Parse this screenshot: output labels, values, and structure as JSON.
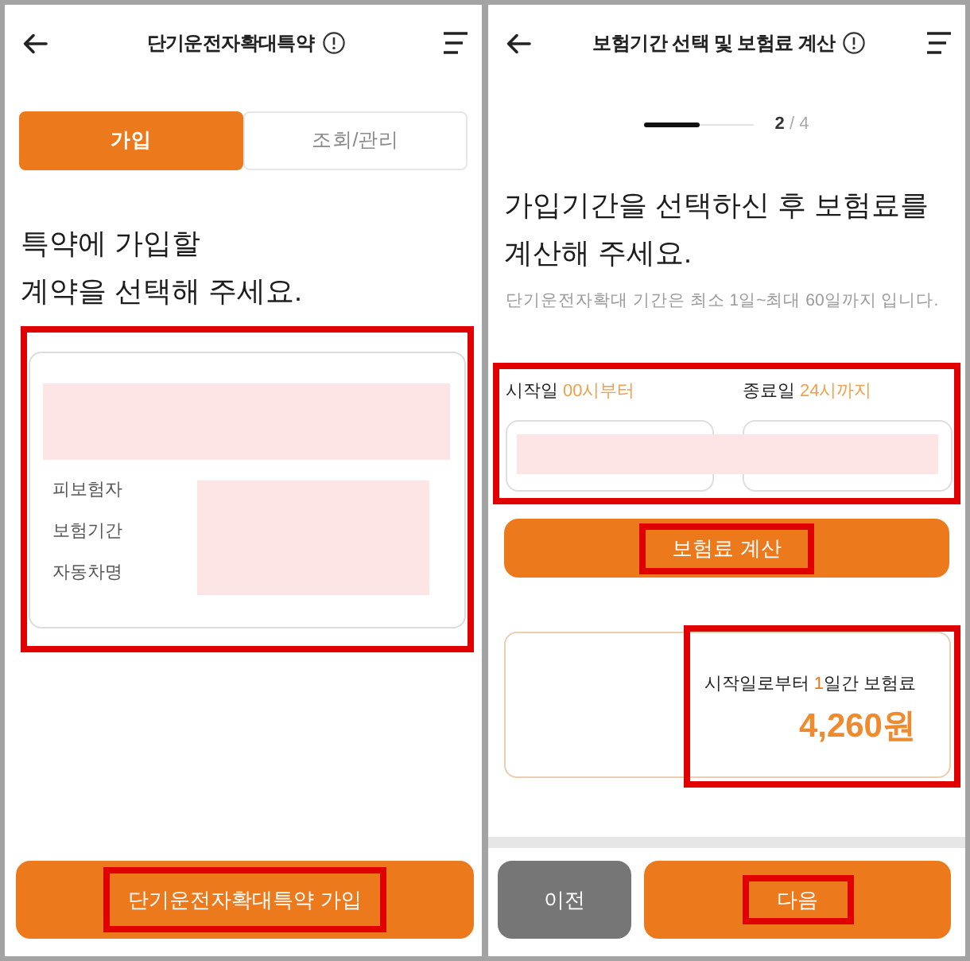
{
  "screens": [
    {
      "kind": "join",
      "header": {
        "title": "단기운전자확대특약"
      },
      "tabs": [
        {
          "label": "가입",
          "selected": true
        },
        {
          "label": "조회/관리",
          "selected": false
        }
      ],
      "heading": "특약에 가입할\n계약을 선택해 주세요.",
      "contract_card": {
        "highlighted": true,
        "title_redacted": true,
        "values_redacted": true,
        "fields": [
          {
            "label": "피보험자"
          },
          {
            "label": "보험기간"
          },
          {
            "label": "자동차명"
          }
        ]
      },
      "footer_buttons": [
        {
          "kind": "submit",
          "label": "단기운전자확대특약 가입",
          "highlighted": true
        }
      ]
    },
    {
      "kind": "period",
      "header": {
        "title": "보험기간 선택 및 보험료 계산"
      },
      "progress": {
        "level": 0.5,
        "step_counter": "**2** / 4"
      },
      "heading": "가입기간을 선택하신 후 보험료를\n계산해 주세요.",
      "note": "단기운전자확대 기간은 최소 1일~최대 60일까지 입니다.",
      "date_fields": {
        "highlighted": true,
        "values_redacted": true,
        "fields": [
          {
            "label": "시작일",
            "hint": "00시부터"
          },
          {
            "label": "종료일",
            "hint": "24시까지"
          }
        ]
      },
      "calculate_button": {
        "label": "보험료 계산",
        "highlighted": true
      },
      "premium": {
        "highlighted": true,
        "caption_prefix": "시작일로부터 ",
        "days": "1",
        "caption_suffix": "일간 보험료",
        "amount": "4,260원"
      },
      "footer_buttons": [
        {
          "kind": "back",
          "label": "이전",
          "highlighted": false
        },
        {
          "kind": "next",
          "label": "다음",
          "highlighted": true
        }
      ]
    }
  ]
}
